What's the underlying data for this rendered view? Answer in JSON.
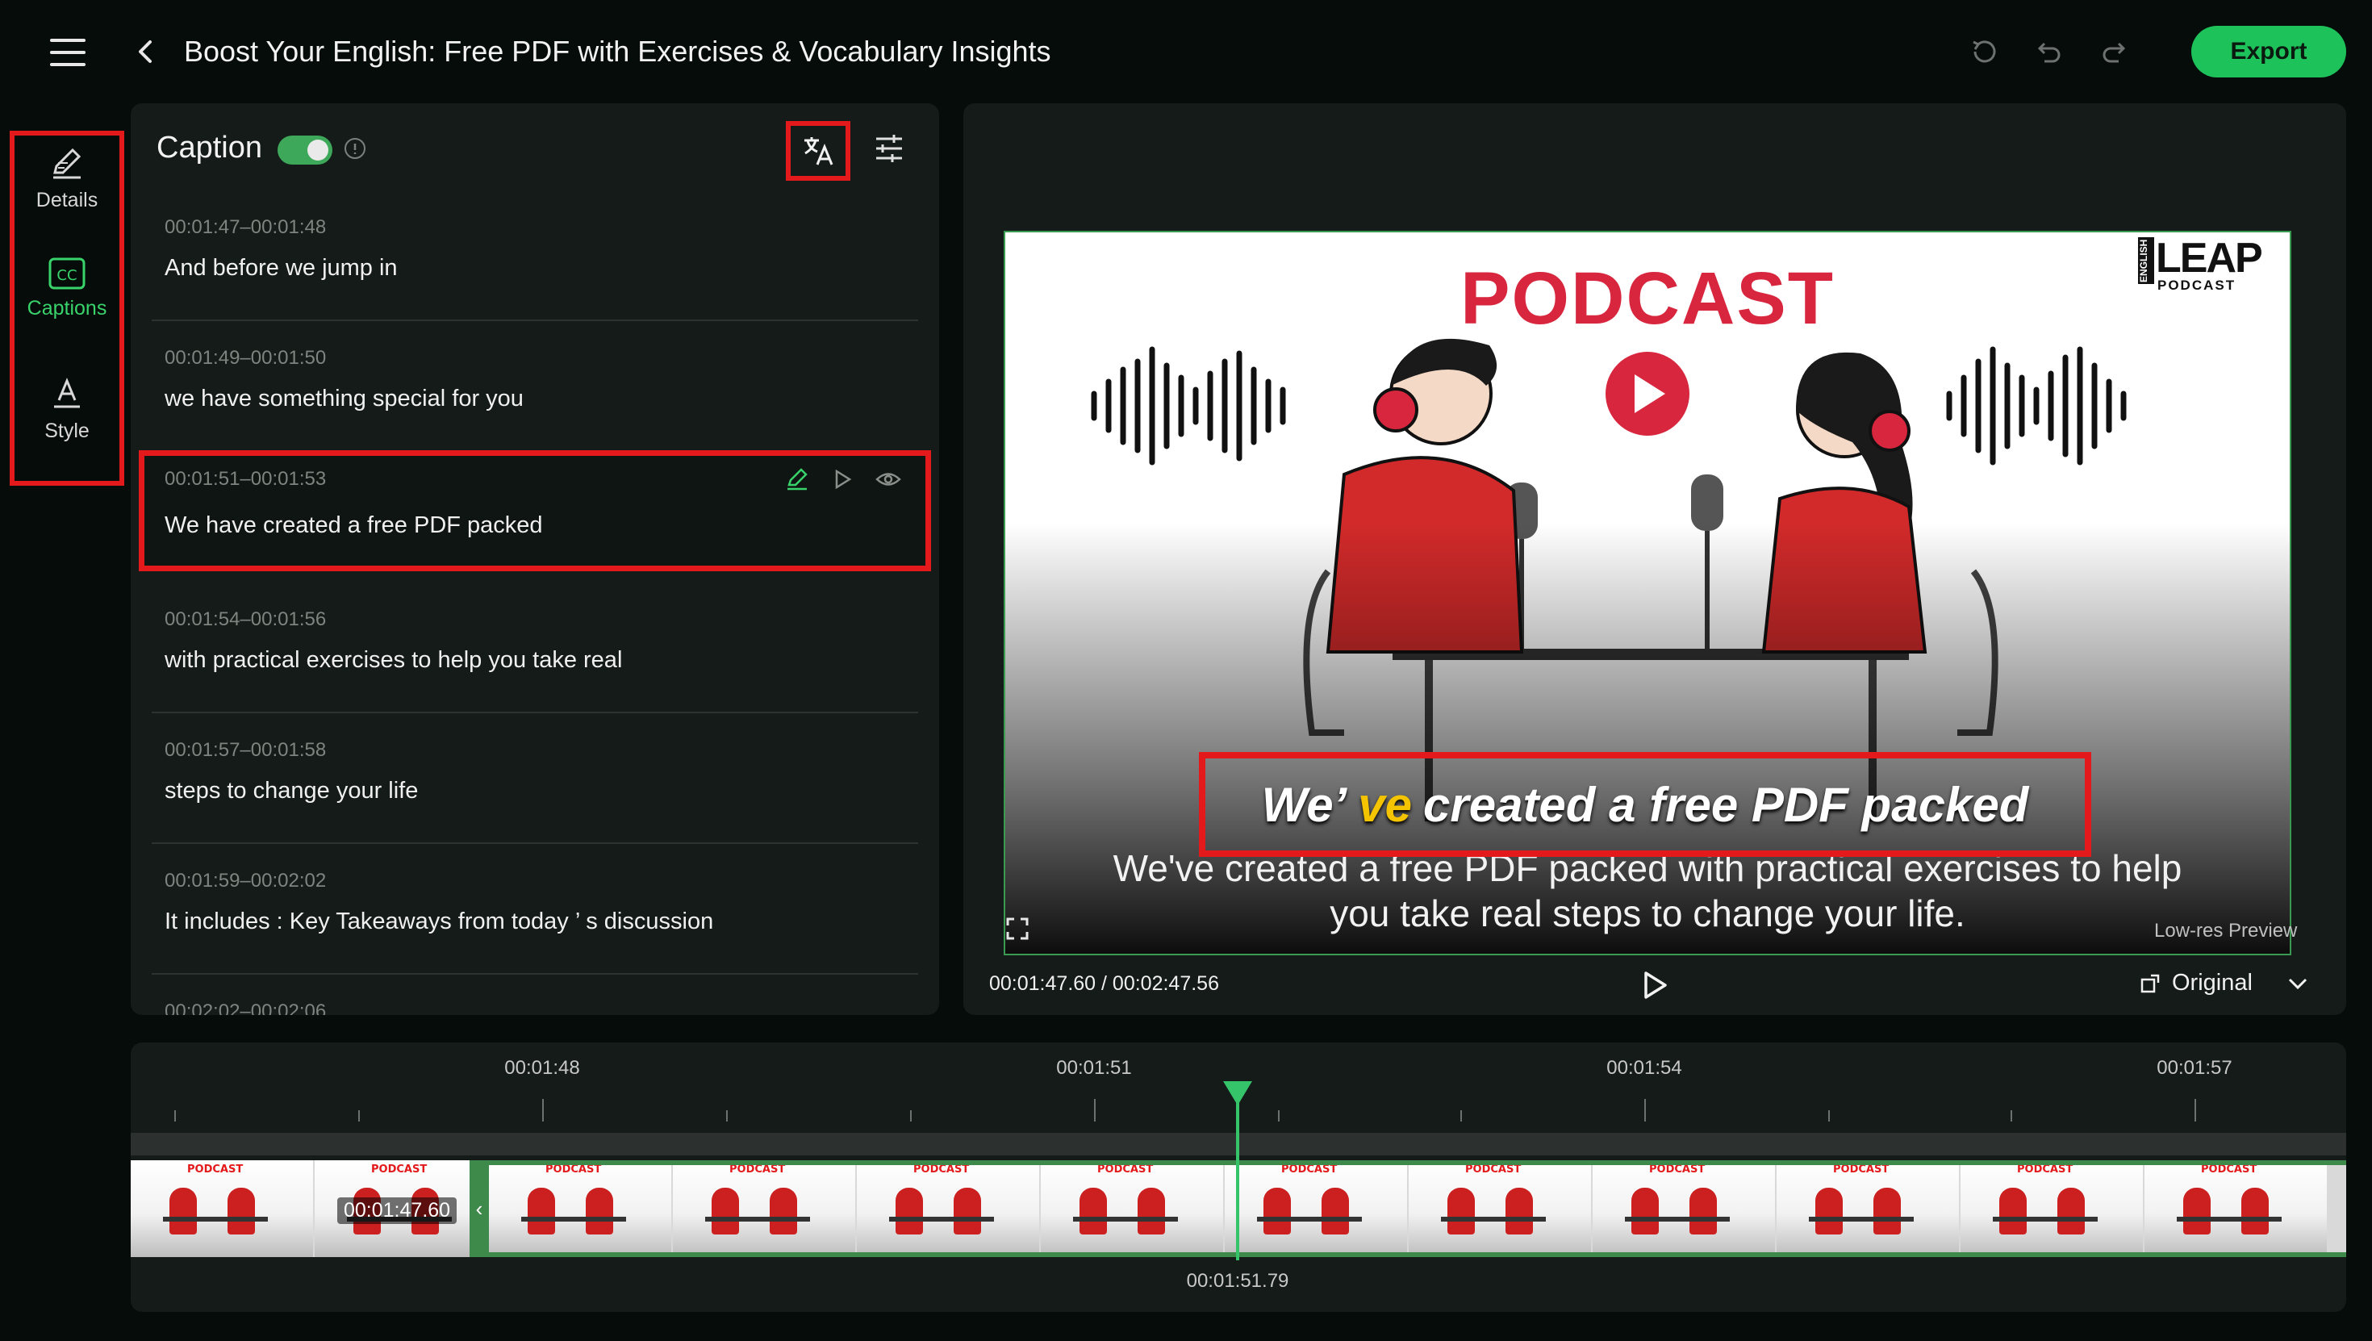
{
  "header": {
    "title": "Boost Your English: Free PDF with Exercises & Vocabulary Insights",
    "export_label": "Export"
  },
  "side_nav": {
    "items": [
      {
        "label": "Details",
        "icon": "edit-icon",
        "active": false
      },
      {
        "label": "Captions",
        "icon": "cc-icon",
        "active": true
      },
      {
        "label": "Style",
        "icon": "text-style-icon",
        "active": false
      }
    ]
  },
  "caption_panel": {
    "title": "Caption",
    "toggle_on": true,
    "items": [
      {
        "time": "00:01:47–00:01:48",
        "text": "And before we jump in"
      },
      {
        "time": "00:01:49–00:01:50",
        "text": "we have something special for you"
      },
      {
        "time": "00:01:51–00:01:53",
        "text": "We have created a free PDF packed",
        "active": true
      },
      {
        "time": "00:01:54–00:01:56",
        "text": "with practical exercises to help you take real"
      },
      {
        "time": "00:01:57–00:01:58",
        "text": "steps to change your life"
      },
      {
        "time": "00:01:59–00:02:02",
        "text": "It includes : Key Takeaways from today ’ s discussion"
      },
      {
        "time": "00:02:02–00:02:06",
        "text": ""
      }
    ]
  },
  "preview": {
    "podcast_title": "PODCAST",
    "logo_text": "LEAP",
    "logo_side": "ENGLISH",
    "logo_sub": "PODCAST",
    "caption_word1": "We’",
    "caption_highlight": "ve",
    "caption_rest": "created a free PDF packed",
    "burned_in_line1": "We've created a free PDF packed with practical exercises to help",
    "burned_in_line2": "you take real steps to change your life.",
    "lowres_label": "Low-res Preview",
    "current_time": "00:01:47.60",
    "total_time": "00:02:47.56",
    "ratio_label": "Original"
  },
  "timeline": {
    "ticks": [
      "00:01:48",
      "00:01:51",
      "00:01:54",
      "00:01:57"
    ],
    "clip_time": "00:01:47.60",
    "playhead_time": "00:01:51.79"
  },
  "colors": {
    "accent": "#1ec25a",
    "highlight_box": "#e3191b",
    "podcast_red": "#d7263d",
    "caption_highlight": "#f5c400"
  }
}
